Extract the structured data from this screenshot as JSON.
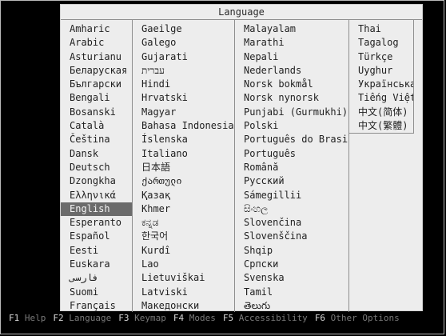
{
  "dialog": {
    "title": "Language",
    "selected": "English",
    "columns": [
      [
        "Amharic",
        "Arabic",
        "Asturianu",
        "Беларуская",
        "Български",
        "Bengali",
        "Bosanski",
        "Català",
        "Čeština",
        "Dansk",
        "Deutsch",
        "Dzongkha",
        "Ελληνικά",
        "English",
        "Esperanto",
        "Español",
        "Eesti",
        "Euskara",
        "فارسی",
        "Suomi",
        "Français"
      ],
      [
        "Gaeilge",
        "Galego",
        "Gujarati",
        "עברית",
        "Hindi",
        "Hrvatski",
        "Magyar",
        "Bahasa Indonesia",
        "Íslenska",
        "Italiano",
        "日本語",
        "ქართული",
        "Қазақ",
        "Khmer",
        "ಕನ್ನಡ",
        "한국어",
        "Kurdî",
        "Lao",
        "Lietuviškai",
        "Latviski",
        "Македонски"
      ],
      [
        "Malayalam",
        "Marathi",
        "Nepali",
        "Nederlands",
        "Norsk bokmål",
        "Norsk nynorsk",
        "Punjabi (Gurmukhi)",
        "Polski",
        "Português do Brasil",
        "Português",
        "Română",
        "Русский",
        "Sámegillii",
        "සිංහල",
        "Slovenčina",
        "Slovenščina",
        "Shqip",
        "Српски",
        "Svenska",
        "Tamil",
        "తెలుగు"
      ],
      [
        "Thai",
        "Tagalog",
        "Türkçe",
        "Uyghur",
        "Українська",
        "Tiếng Việt",
        "中文(简体)",
        "中文(繁體)"
      ]
    ]
  },
  "footer": {
    "keys": [
      {
        "key": "F1",
        "label": "Help"
      },
      {
        "key": "F2",
        "label": "Language"
      },
      {
        "key": "F3",
        "label": "Keymap"
      },
      {
        "key": "F4",
        "label": "Modes"
      },
      {
        "key": "F5",
        "label": "Accessibility"
      },
      {
        "key": "F6",
        "label": "Other Options"
      }
    ]
  }
}
